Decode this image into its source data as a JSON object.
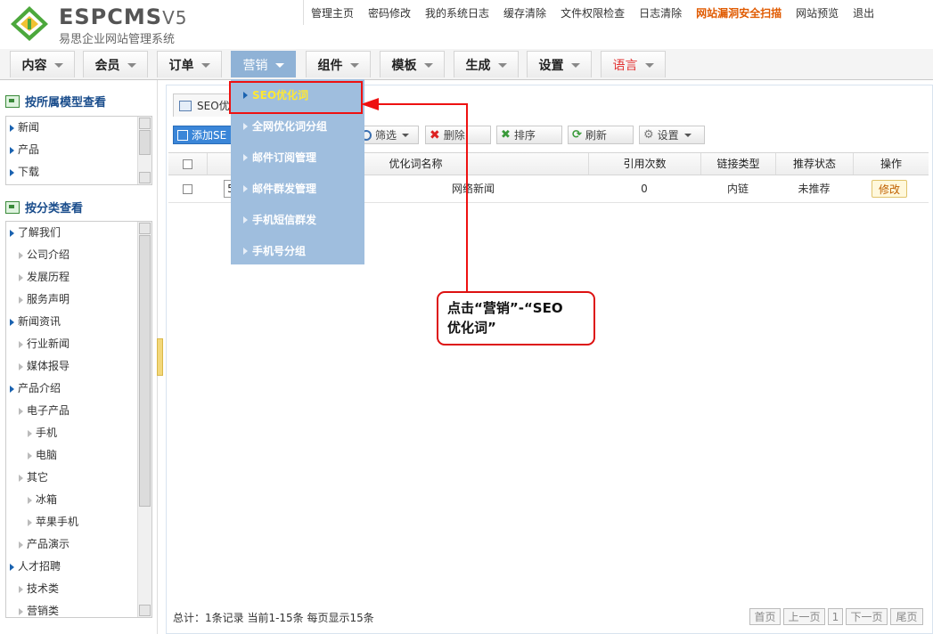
{
  "brand": {
    "logo_text": "ESPCMS",
    "logo_version": "V5",
    "subtitle": "易思企业网站管理系统"
  },
  "top_links": [
    {
      "label": "管理主页",
      "highlight": false
    },
    {
      "label": "密码修改",
      "highlight": false
    },
    {
      "label": "我的系统日志",
      "highlight": false
    },
    {
      "label": "缓存清除",
      "highlight": false
    },
    {
      "label": "文件权限检查",
      "highlight": false
    },
    {
      "label": "日志清除",
      "highlight": false
    },
    {
      "label": "网站漏洞安全扫描",
      "highlight": true
    },
    {
      "label": "网站预览",
      "highlight": false
    },
    {
      "label": "退出",
      "highlight": false
    }
  ],
  "nav": {
    "tabs": [
      {
        "label": "内容"
      },
      {
        "label": "会员"
      },
      {
        "label": "订单"
      },
      {
        "label": "营销",
        "active": true
      },
      {
        "label": "组件"
      },
      {
        "label": "模板"
      },
      {
        "label": "生成"
      },
      {
        "label": "设置"
      },
      {
        "label": "语言",
        "color": "#e33333"
      }
    ]
  },
  "sidebar": {
    "model_section_title": "按所属模型查看",
    "model_items": [
      "新闻",
      "产品",
      "下载"
    ],
    "category_section_title": "按分类查看",
    "category_items": [
      {
        "label": "了解我们",
        "level": 0
      },
      {
        "label": "公司介绍",
        "level": 1
      },
      {
        "label": "发展历程",
        "level": 1
      },
      {
        "label": "服务声明",
        "level": 1
      },
      {
        "label": "新闻资讯",
        "level": 0
      },
      {
        "label": "行业新闻",
        "level": 1
      },
      {
        "label": "媒体报导",
        "level": 1
      },
      {
        "label": "产品介绍",
        "level": 0
      },
      {
        "label": "电子产品",
        "level": 1
      },
      {
        "label": "手机",
        "level": 2
      },
      {
        "label": "电脑",
        "level": 2
      },
      {
        "label": "其它",
        "level": 1
      },
      {
        "label": "冰箱",
        "level": 2
      },
      {
        "label": "苹果手机",
        "level": 2
      },
      {
        "label": "产品演示",
        "level": 1
      },
      {
        "label": "人才招聘",
        "level": 0
      },
      {
        "label": "技术类",
        "level": 1
      },
      {
        "label": "营销类",
        "level": 1
      }
    ]
  },
  "main": {
    "tab_title": "SEO优",
    "toolbar": {
      "add": "添加SE",
      "filter": "筛选",
      "delete": "删除",
      "sort": "排序",
      "refresh": "刷新",
      "settings": "设置"
    },
    "table": {
      "columns": [
        "",
        "",
        "优化词名称",
        "引用次数",
        "链接类型",
        "推荐状态",
        "操作"
      ],
      "rows": [
        {
          "id_prefix": "5",
          "name": "网络新闻",
          "refs": "0",
          "link_type": "内链",
          "status": "未推荐",
          "action": "修改"
        }
      ]
    },
    "footer": {
      "total": "总计：1条记录 当前1-15条 每页显示15条",
      "pager": [
        "首页",
        "上一页",
        "1",
        "下一页",
        "尾页"
      ]
    }
  },
  "dropdown": {
    "items": [
      "SEO优化词",
      "全网优化词分组",
      "邮件订阅管理",
      "邮件群发管理",
      "手机短信群发",
      "手机号分组"
    ]
  },
  "annotation": {
    "line1": "点击“营销”-“SEO",
    "line2": "优化词”"
  }
}
